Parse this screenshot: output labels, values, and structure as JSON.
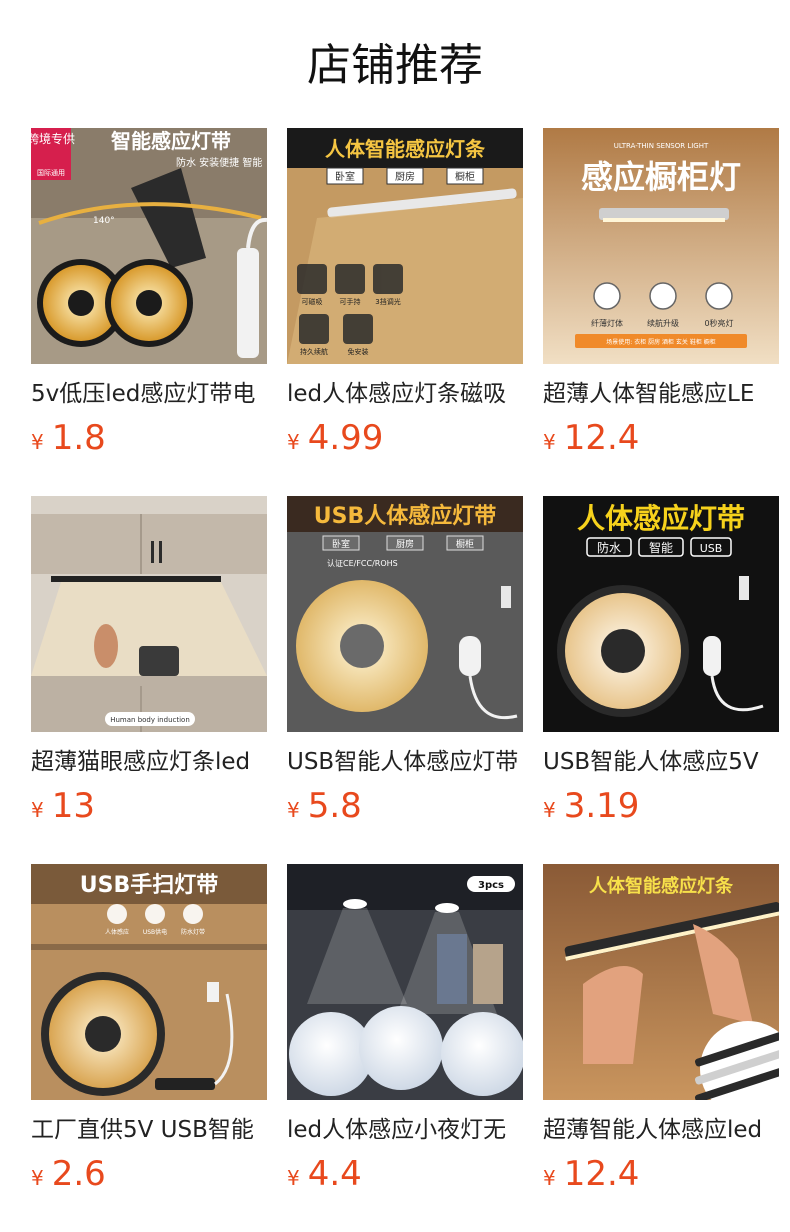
{
  "section": {
    "title": "店铺推荐"
  },
  "colors": {
    "price": "#e8491d",
    "title": "#111111",
    "text": "#222222"
  },
  "products": [
    {
      "name": "5v低压led感应灯带电",
      "currency": "¥",
      "price": "1.8",
      "image_text": {
        "badge": "跨境专供",
        "badge_sub": "国际通用",
        "headline": "智能感应灯带",
        "sub": "防水 安装便捷 智能",
        "angle": "140°"
      }
    },
    {
      "name": "led人体感应灯条磁吸",
      "currency": "¥",
      "price": "4.99",
      "image_text": {
        "headline": "人体智能感应灯条",
        "tags": [
          "卧室",
          "厨房",
          "橱柜"
        ],
        "features": [
          "可磁吸",
          "可手持",
          "3挡调光",
          "持久续航",
          "免安装"
        ]
      }
    },
    {
      "name": "超薄人体智能感应LE",
      "currency": "¥",
      "price": "12.4",
      "image_text": {
        "top": "ULTRA-THIN SENSOR LIGHT",
        "headline": "感应橱柜灯",
        "features": [
          "纤薄灯体",
          "续航升级",
          "0秒亮灯"
        ],
        "scene": "场景使用: 衣柜 厨房 酒柜 玄关 鞋柜 橱柜"
      }
    },
    {
      "name": "超薄猫眼感应灯条led",
      "currency": "¥",
      "price": "13",
      "image_text": {
        "caption": "Human body induction"
      }
    },
    {
      "name": "USB智能人体感应灯带",
      "currency": "¥",
      "price": "5.8",
      "image_text": {
        "headline": "USB人体感应灯带",
        "tags": [
          "卧室",
          "厨房",
          "橱柜"
        ],
        "cert": "认证CE/FCC/ROHS"
      }
    },
    {
      "name": "USB智能人体感应5V",
      "currency": "¥",
      "price": "3.19",
      "image_text": {
        "headline": "人体感应灯带",
        "tags": [
          "防水",
          "智能",
          "USB"
        ]
      }
    },
    {
      "name": "工厂直供5V USB智能",
      "currency": "¥",
      "price": "2.6",
      "image_text": {
        "headline": "USB手扫灯带",
        "features": [
          "人体感应",
          "USB供电",
          "防水灯带"
        ]
      }
    },
    {
      "name": "led人体感应小夜灯无",
      "currency": "¥",
      "price": "4.4",
      "image_text": {
        "badge": "3pcs"
      }
    },
    {
      "name": "超薄智能人体感应led",
      "currency": "¥",
      "price": "12.4",
      "image_text": {
        "headline": "人体智能感应灯条"
      }
    }
  ]
}
